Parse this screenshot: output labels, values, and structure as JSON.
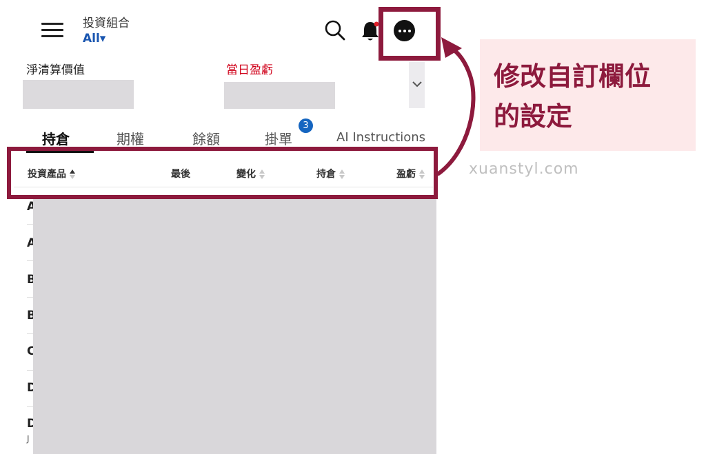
{
  "header": {
    "portfolio_title": "投資組合",
    "portfolio_select": "All▾"
  },
  "summary": {
    "nav_label": "淨清算價值",
    "pnl_label": "當日盈虧"
  },
  "tabs": [
    {
      "label": "持倉"
    },
    {
      "label": "期權"
    },
    {
      "label": "餘額"
    },
    {
      "label": "掛單",
      "badge": "3"
    },
    {
      "label": "AI Instructions"
    }
  ],
  "columns": [
    {
      "label": "投資產品"
    },
    {
      "label": "最後"
    },
    {
      "label": "變化"
    },
    {
      "label": "持倉"
    },
    {
      "label": "盈虧"
    }
  ],
  "rows": [
    {
      "initial": "A"
    },
    {
      "initial": "A"
    },
    {
      "initial": "B"
    },
    {
      "initial": "B"
    },
    {
      "initial": "C"
    },
    {
      "initial": "D"
    },
    {
      "initial": "D",
      "sub": "J"
    }
  ],
  "annotation": {
    "text_line1": "修改自訂欄位",
    "text_line2": "的設定",
    "watermark": "xuanstyl.com"
  },
  "colors": {
    "accent_highlight": "#8d1a3d",
    "pnl_red": "#d0021b",
    "link_blue": "#1a56b0",
    "badge_blue": "#1565c0",
    "annotation_bg": "#fde9ea"
  },
  "icons": [
    "menu-icon",
    "search-icon",
    "bell-icon",
    "more-icon",
    "chevron-down-icon",
    "sort-icon"
  ]
}
